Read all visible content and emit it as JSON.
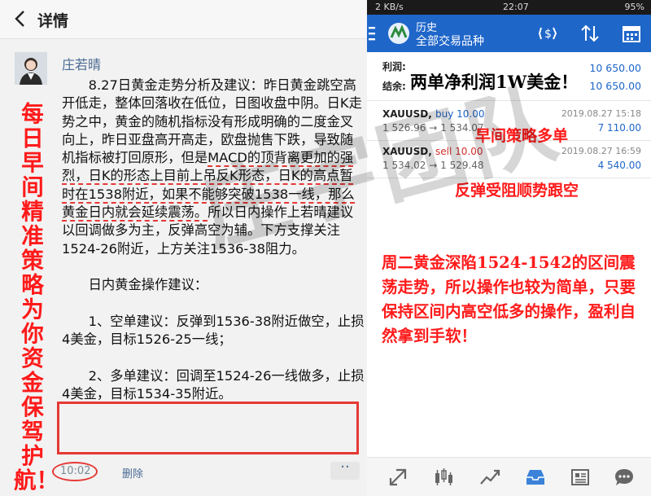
{
  "left": {
    "header": {
      "title": "详情"
    },
    "author": {
      "name": "庄若晴"
    },
    "post": {
      "p1_a": "8.27日黄金走势分析及建议：昨日黄金跳空高开低走，整体回落收在低位，日图收盘中阴。日K走势之中，黄金的随机指标没有形成明确的二度金叉向上，昨日亚盘高开高走，欧盘抛售下跌，导致随机指标被打回原形，但是",
      "p1_b": "MACD的顶背离更加的强烈，日K的形态上目前上吊反K形态，日K的高点暂时在1538附近，如果不能够突破1538一线，那么黄金日内就会延续震荡。",
      "p1_c": "所以日内操作上若晴建议以回调做多为主，反弹高空为辅。下方支撑关注1524-26附近，上方关注1536-38阻力。",
      "heading": "日内黄金操作建议：",
      "short": "1、空单建议：反弹到1536-38附近做空，止损4美金，目标1526-25一线；",
      "long": "2、多单建议：回调至1524-26一线做多，止损4美金，目标1534-35附近。"
    },
    "timestamp": "10:02",
    "delete_label": "删除",
    "more_label": "··",
    "side_slogan": "每日早间精准策略为你资金保驾护航！"
  },
  "watermark": "庄宇团队",
  "right": {
    "status": {
      "left": "2 KB/s",
      "time": "22:07",
      "battery": "95%"
    },
    "app_bar": {
      "title": "历史",
      "subtitle": "全部交易品种"
    },
    "summary": {
      "profit_label": "利润:",
      "profit_value": "10 650.00",
      "balance_label": "结余:",
      "balance_value": "10 650.00",
      "note": "两单净利润1W美金！"
    },
    "trades": [
      {
        "symbol": "XAUUSD,",
        "side": "buy 10.00",
        "prices": "1 526.96 → 1 534.07",
        "date": "2019.08.27 15:18",
        "profit": "7 110.00"
      },
      {
        "symbol": "XAUUSD,",
        "side": "sell 10.00",
        "prices": "1 534.02 → 1 529.48",
        "date": "2019.08.27 16:59",
        "profit": "4 540.00"
      }
    ],
    "annotations": {
      "morning": "早间策略多单",
      "rebound": "反弹受阻顺势跟空",
      "summary": "周二黄金深陷1524-1542的区间震荡走势，所以操作也较为简单，只要保持区间内高空低多的操作，盈利自然拿到手软！"
    }
  },
  "colors": {
    "accent": "#1f66c9",
    "annotation_red": "#ff1a1a"
  }
}
